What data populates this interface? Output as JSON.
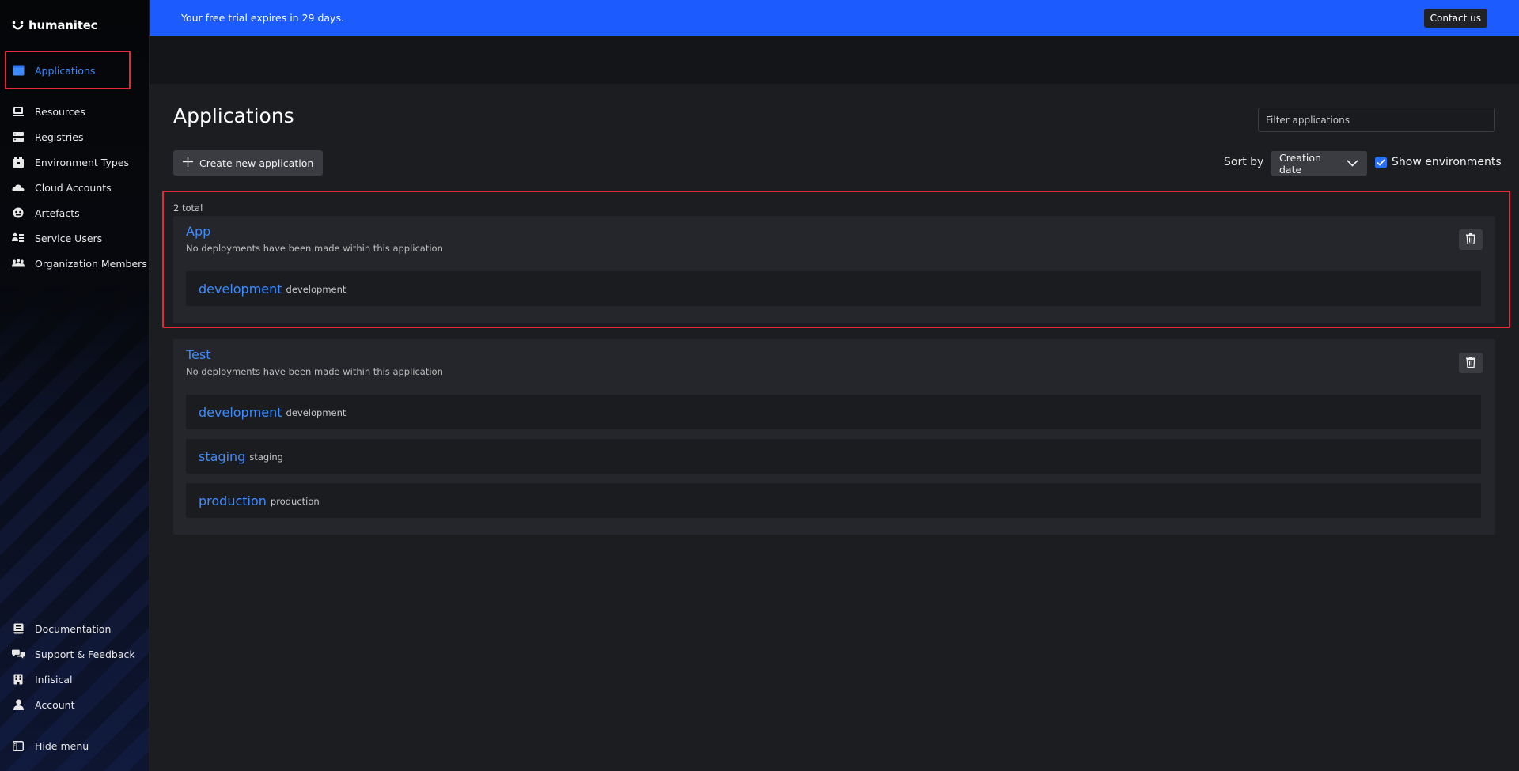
{
  "logo": {
    "text": "humanitec"
  },
  "sidebar": {
    "items": [
      {
        "label": "Applications",
        "icon": "applications-icon"
      },
      {
        "label": "Resources",
        "icon": "resources-icon"
      },
      {
        "label": "Registries",
        "icon": "registries-icon"
      },
      {
        "label": "Environment Types",
        "icon": "environment-types-icon"
      },
      {
        "label": "Cloud Accounts",
        "icon": "cloud-accounts-icon"
      },
      {
        "label": "Artefacts",
        "icon": "artefacts-icon"
      },
      {
        "label": "Service Users",
        "icon": "service-users-icon"
      },
      {
        "label": "Organization Members",
        "icon": "organization-members-icon"
      }
    ],
    "bottom_items": [
      {
        "label": "Documentation",
        "icon": "documentation-icon"
      },
      {
        "label": "Support & Feedback",
        "icon": "support-feedback-icon"
      },
      {
        "label": "Infisical",
        "icon": "building-icon"
      },
      {
        "label": "Account",
        "icon": "account-icon"
      }
    ],
    "hide_menu": "Hide menu"
  },
  "banner": {
    "text": "Your free trial expires in 29 days.",
    "contact_label": "Contact us"
  },
  "page": {
    "title": "Applications",
    "filter_placeholder": "Filter applications",
    "create_label": "Create new application",
    "sort_label": "Sort by",
    "sort_value": "Creation date",
    "show_env_label": "Show environments",
    "show_env_checked": true,
    "total": "2 total"
  },
  "applications": [
    {
      "name": "App",
      "desc": "No deployments have been made within this application",
      "envs": [
        {
          "name": "development",
          "id": "development"
        }
      ]
    },
    {
      "name": "Test",
      "desc": "No deployments have been made within this application",
      "envs": [
        {
          "name": "development",
          "id": "development"
        },
        {
          "name": "staging",
          "id": "staging"
        },
        {
          "name": "production",
          "id": "production"
        }
      ]
    }
  ],
  "colors": {
    "accent": "#3d8bff",
    "banner": "#1c5cff",
    "highlight": "#e5283c"
  }
}
